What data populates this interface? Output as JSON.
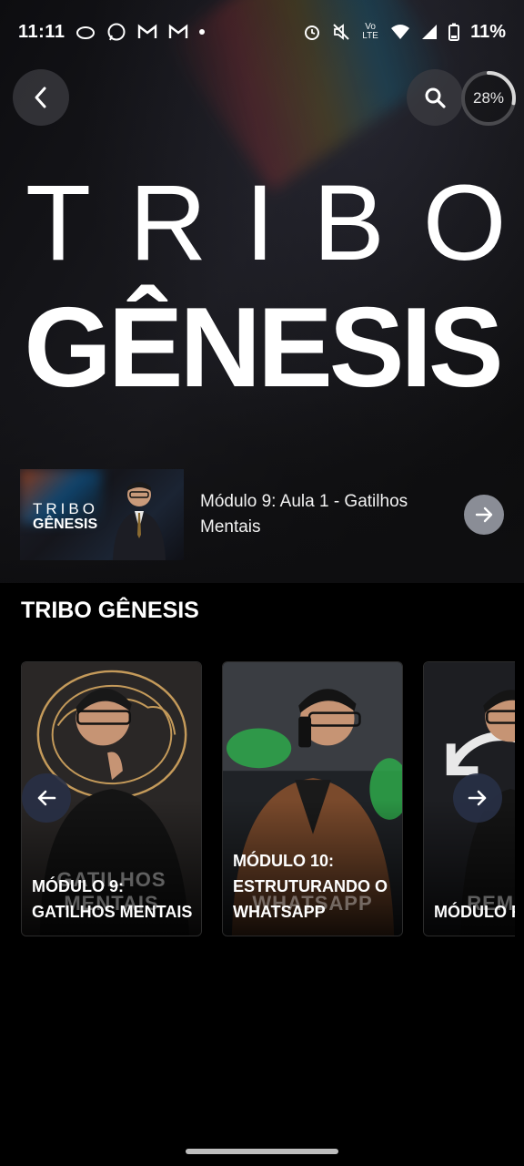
{
  "status_bar": {
    "time": "11:11",
    "battery": "11%",
    "left_icons": [
      "cloud-icon",
      "whatsapp-icon",
      "gmail-icon",
      "gmail-icon",
      "dot-icon"
    ],
    "right_icons": [
      "alarm-icon",
      "mute-icon",
      "volte-icon",
      "wifi-icon",
      "signal-icon",
      "battery-icon"
    ],
    "network_label": "Vo LTE"
  },
  "header": {
    "progress_label": "28%",
    "progress_value": 0.28
  },
  "hero": {
    "title_top": "TRIBO",
    "title_main": "GÊNESIS"
  },
  "continue_watching": {
    "thumb_line1": "TRIBO",
    "thumb_line2": "GÊNESIS",
    "lesson": "Módulo 9: Aula 1 - Gatilhos Mentais"
  },
  "section": {
    "title": "TRIBO GÊNESIS",
    "modules": [
      {
        "label": "MÓDULO 9: GATILHOS MENTAIS",
        "watermark": "GATILHOS MENTAIS"
      },
      {
        "label": "MÓDULO 10: ESTRUTURANDO O WHATSAPP",
        "watermark": "WHATSAPP"
      },
      {
        "label": "MÓDULO REMARKE",
        "watermark": "REMARK"
      }
    ]
  },
  "colors": {
    "background": "#000000",
    "hero_bg": "#121214",
    "button_bg": "#3c3c41",
    "arrow_bg": "#8a8d96",
    "carousel_arrow_bg": "#283046",
    "text": "#ffffff"
  }
}
